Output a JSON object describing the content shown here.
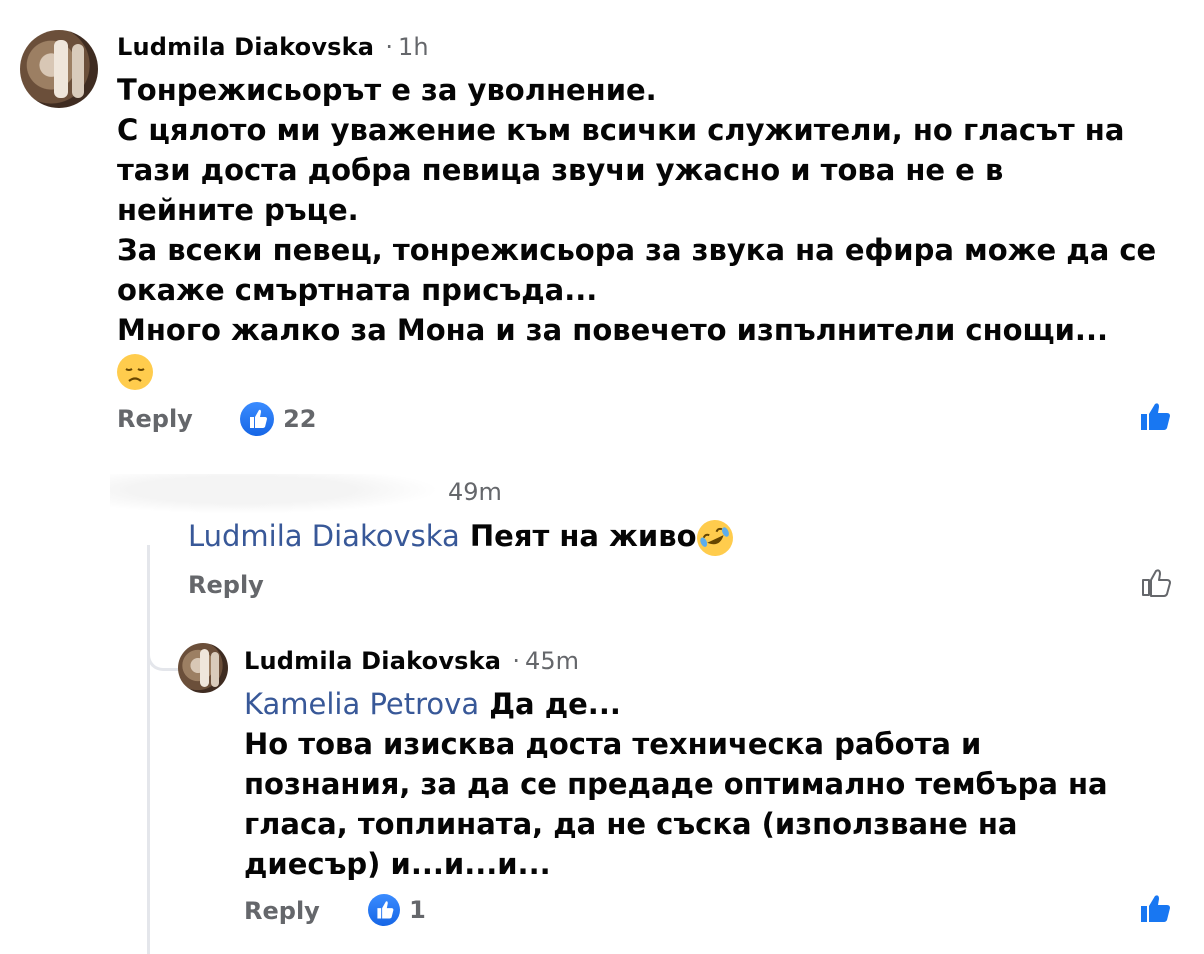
{
  "comment1": {
    "author": "Ludmila Diakovska",
    "separator": "·",
    "time": "1h",
    "lines": [
      "Тонрежисьорът е за уволнение.",
      "С цялото ми уважение към всички служители, но гласът на",
      "тази доста добра певица звучи ужасно и това не е в",
      "нейните ръце.",
      "За всеки певец, тонрежисьора за звука на ефира може  да се",
      "окаже смъртната присъда...",
      "Много жалко за Мона и за повечето изпълнители снощи..."
    ],
    "emoji": "disappointed-face",
    "reply_label": "Reply",
    "like_count": "22"
  },
  "reply1": {
    "time": "49m",
    "mention": "Ludmila Diakovska",
    "text": "Пеят на живо",
    "emoji": "rolling-on-floor-laughing",
    "reply_label": "Reply"
  },
  "reply2": {
    "author": "Ludmila Diakovska",
    "separator": "·",
    "time": "45m",
    "mention": "Kamelia Petrova",
    "first_line_text": "Да де...",
    "lines": [
      "Но това изисква доста техническа работа и",
      "познания, за да се предаде оптимално тембъра на",
      "гласа, топлината, да не съска (използване на",
      "диесър) и...и...и..."
    ],
    "reply_label": "Reply",
    "like_count": "1"
  },
  "colors": {
    "link": "#385898",
    "secondary": "#65676b",
    "like_blue": "#1877f2"
  }
}
